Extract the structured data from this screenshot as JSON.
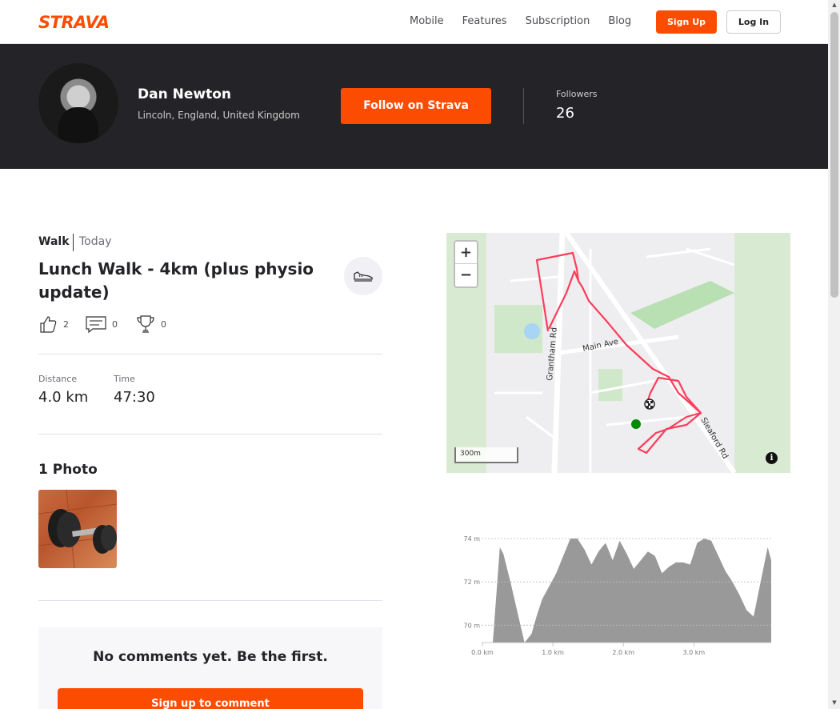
{
  "nav": {
    "logo": "STRAVA",
    "links": [
      "Mobile",
      "Features",
      "Subscription",
      "Blog"
    ],
    "signup": "Sign Up",
    "login": "Log In"
  },
  "profile": {
    "name": "Dan Newton",
    "location": "Lincoln, England, United Kingdom",
    "follow_button": "Follow on Strava",
    "followers_label": "Followers",
    "followers_count": "26"
  },
  "activity": {
    "type": "Walk",
    "date": "Today",
    "title": "Lunch Walk - 4km (plus physio update)",
    "kudos": "2",
    "comments": "0",
    "achievements": "0",
    "stats": [
      {
        "label": "Distance",
        "value": "4.0 km"
      },
      {
        "label": "Time",
        "value": "47:30"
      }
    ],
    "photos_heading": "1 Photo",
    "no_comments": "No comments yet. Be the first.",
    "comment_button": "Sign up to comment"
  },
  "map": {
    "zoom_in": "+",
    "zoom_out": "−",
    "scale": "300m",
    "street_labels": [
      "Grantham Rd",
      "Main Ave",
      "Sleaford Rd"
    ],
    "info": "i",
    "route_color": "#fc3d5b"
  },
  "chart_data": {
    "type": "area",
    "title": "",
    "xlabel": "",
    "ylabel": "",
    "x_ticks": [
      "0.0 km",
      "1.0 km",
      "2.0 km",
      "3.0 km"
    ],
    "y_ticks": [
      "70 m",
      "72 m",
      "74 m"
    ],
    "xlim": [
      0,
      3.95
    ],
    "ylim": [
      69.2,
      74
    ],
    "x": [
      0.0,
      0.1,
      0.15,
      0.25,
      0.35,
      0.45,
      0.55,
      0.62,
      0.7,
      0.8,
      0.9,
      1.0,
      1.1,
      1.2,
      1.3,
      1.4,
      1.5,
      1.6,
      1.7,
      1.8,
      1.9,
      2.0,
      2.1,
      2.2,
      2.3,
      2.4,
      2.5,
      2.6,
      2.7,
      2.8,
      2.9,
      3.0,
      3.1,
      3.2,
      3.3,
      3.4,
      3.5,
      3.6,
      3.7,
      3.8,
      3.9,
      3.95
    ],
    "y": [
      69.2,
      73.6,
      73.3,
      72.0,
      70.6,
      69.2,
      69.6,
      70.4,
      71.2,
      71.8,
      72.4,
      73.2,
      74.0,
      74.0,
      73.5,
      72.8,
      73.4,
      73.8,
      73.0,
      73.9,
      73.3,
      72.6,
      73.0,
      73.4,
      73.2,
      72.4,
      72.7,
      72.9,
      72.9,
      72.8,
      73.8,
      74.0,
      73.9,
      73.2,
      72.5,
      72.0,
      71.4,
      70.7,
      70.4,
      72.0,
      73.6,
      73.0
    ],
    "grid": true,
    "fill_color": "#999999"
  },
  "scrollbar": {
    "up": "▲",
    "down": "▼"
  }
}
